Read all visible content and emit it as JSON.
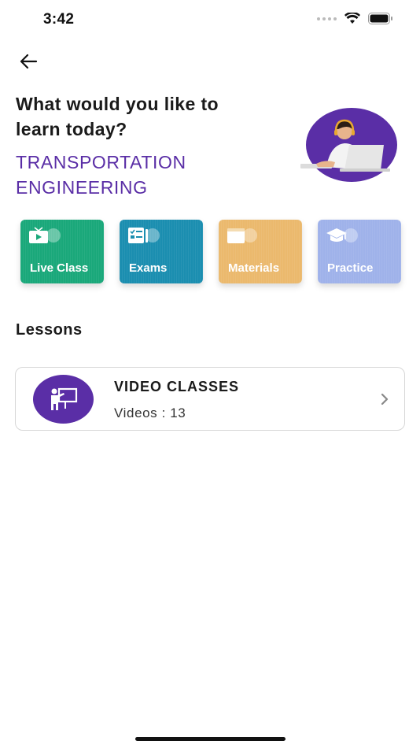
{
  "status_bar": {
    "time": "3:42"
  },
  "header": {
    "headline": "What would you like to learn today?",
    "subject": "TRANSPORTATION ENGINEERING"
  },
  "tiles": [
    {
      "label": "Live Class",
      "icon": "tv-play-icon",
      "color": "#1aa87a"
    },
    {
      "label": "Exams",
      "icon": "exam-sheet-icon",
      "color": "#1b8eb0"
    },
    {
      "label": "Materials",
      "icon": "book-icon",
      "color": "#ebb96d"
    },
    {
      "label": "Practice",
      "icon": "graduation-cap-icon",
      "color": "#9fb2ea"
    }
  ],
  "lessons": {
    "title": "Lessons",
    "items": [
      {
        "title": "VIDEO CLASSES",
        "count_text": "Videos : 13",
        "icon": "teacher-board-icon"
      }
    ]
  },
  "colors": {
    "accent": "#5a2ea6"
  }
}
